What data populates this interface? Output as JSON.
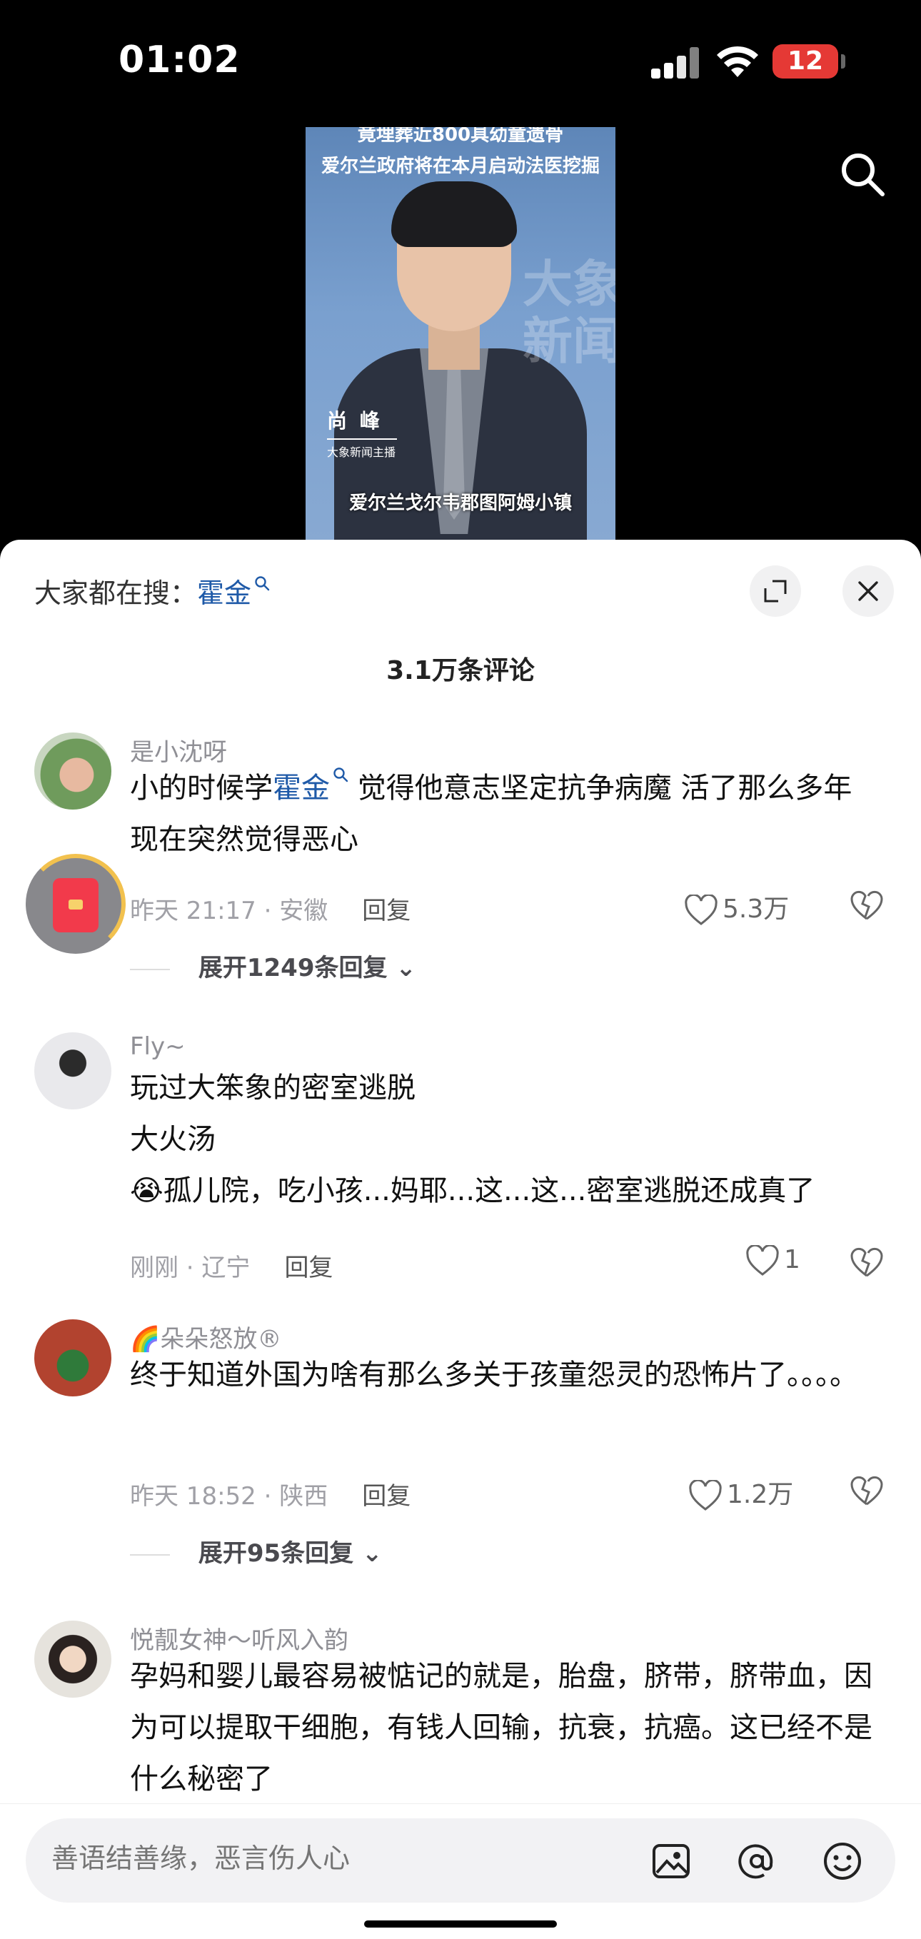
{
  "status_bar": {
    "time": "01:02",
    "battery": "12"
  },
  "video": {
    "banner_line1": "竟埋葬近800具幼童遗骨",
    "banner_line2": "爱尔兰政府将在本月启动法医挖掘",
    "watermark": "大象新闻",
    "anchor_name": "尚 峰",
    "anchor_title": "大象新闻主播",
    "subtitle": "爱尔兰戈尔韦郡图阿姆小镇"
  },
  "sheet": {
    "search_prefix": "大家都在搜：",
    "search_keyword": "霍金",
    "comment_count": "3.1万条评论"
  },
  "comments": [
    {
      "user": "是小沈呀",
      "text_a": "小的时候学",
      "keyword": "霍金",
      "text_b": " 觉得他意志坚定抗争病魔 活了那么多年 现在突然觉得恶心",
      "meta": "昨天 21:17 · 安徽",
      "reply": "回复",
      "likes": "5.3万",
      "expand": "展开1249条回复"
    },
    {
      "user": "Fly~",
      "line1": "玩过大笨象的密室逃脱",
      "line2": "大火汤",
      "line3_emoji": "😭",
      "line3": "孤儿院，吃小孩...妈耶...这...这...密室逃脱还成真了",
      "meta": "刚刚 · 辽宁",
      "reply": "回复",
      "likes": "1"
    },
    {
      "user": "🌈朵朵怒放®",
      "text": "终于知道外国为啥有那么多关于孩童怨灵的恐怖片了。。。。",
      "meta": "昨天 18:52 · 陕西",
      "reply": "回复",
      "likes": "1.2万",
      "expand": "展开95条回复"
    },
    {
      "user": "悦靓女神～听风入韵",
      "text": "孕妈和婴儿最容易被惦记的就是，胎盘，脐带，脐带血，因为可以提取干细胞，有钱人回输，抗衰，抗癌。这已经不是什么秘密了"
    }
  ],
  "input": {
    "placeholder": "善语结善缘，恶言伤人心"
  },
  "colors": {
    "keyword": "#1f5aa8",
    "battery": "#e53935",
    "redpack": "#f23a4b"
  }
}
